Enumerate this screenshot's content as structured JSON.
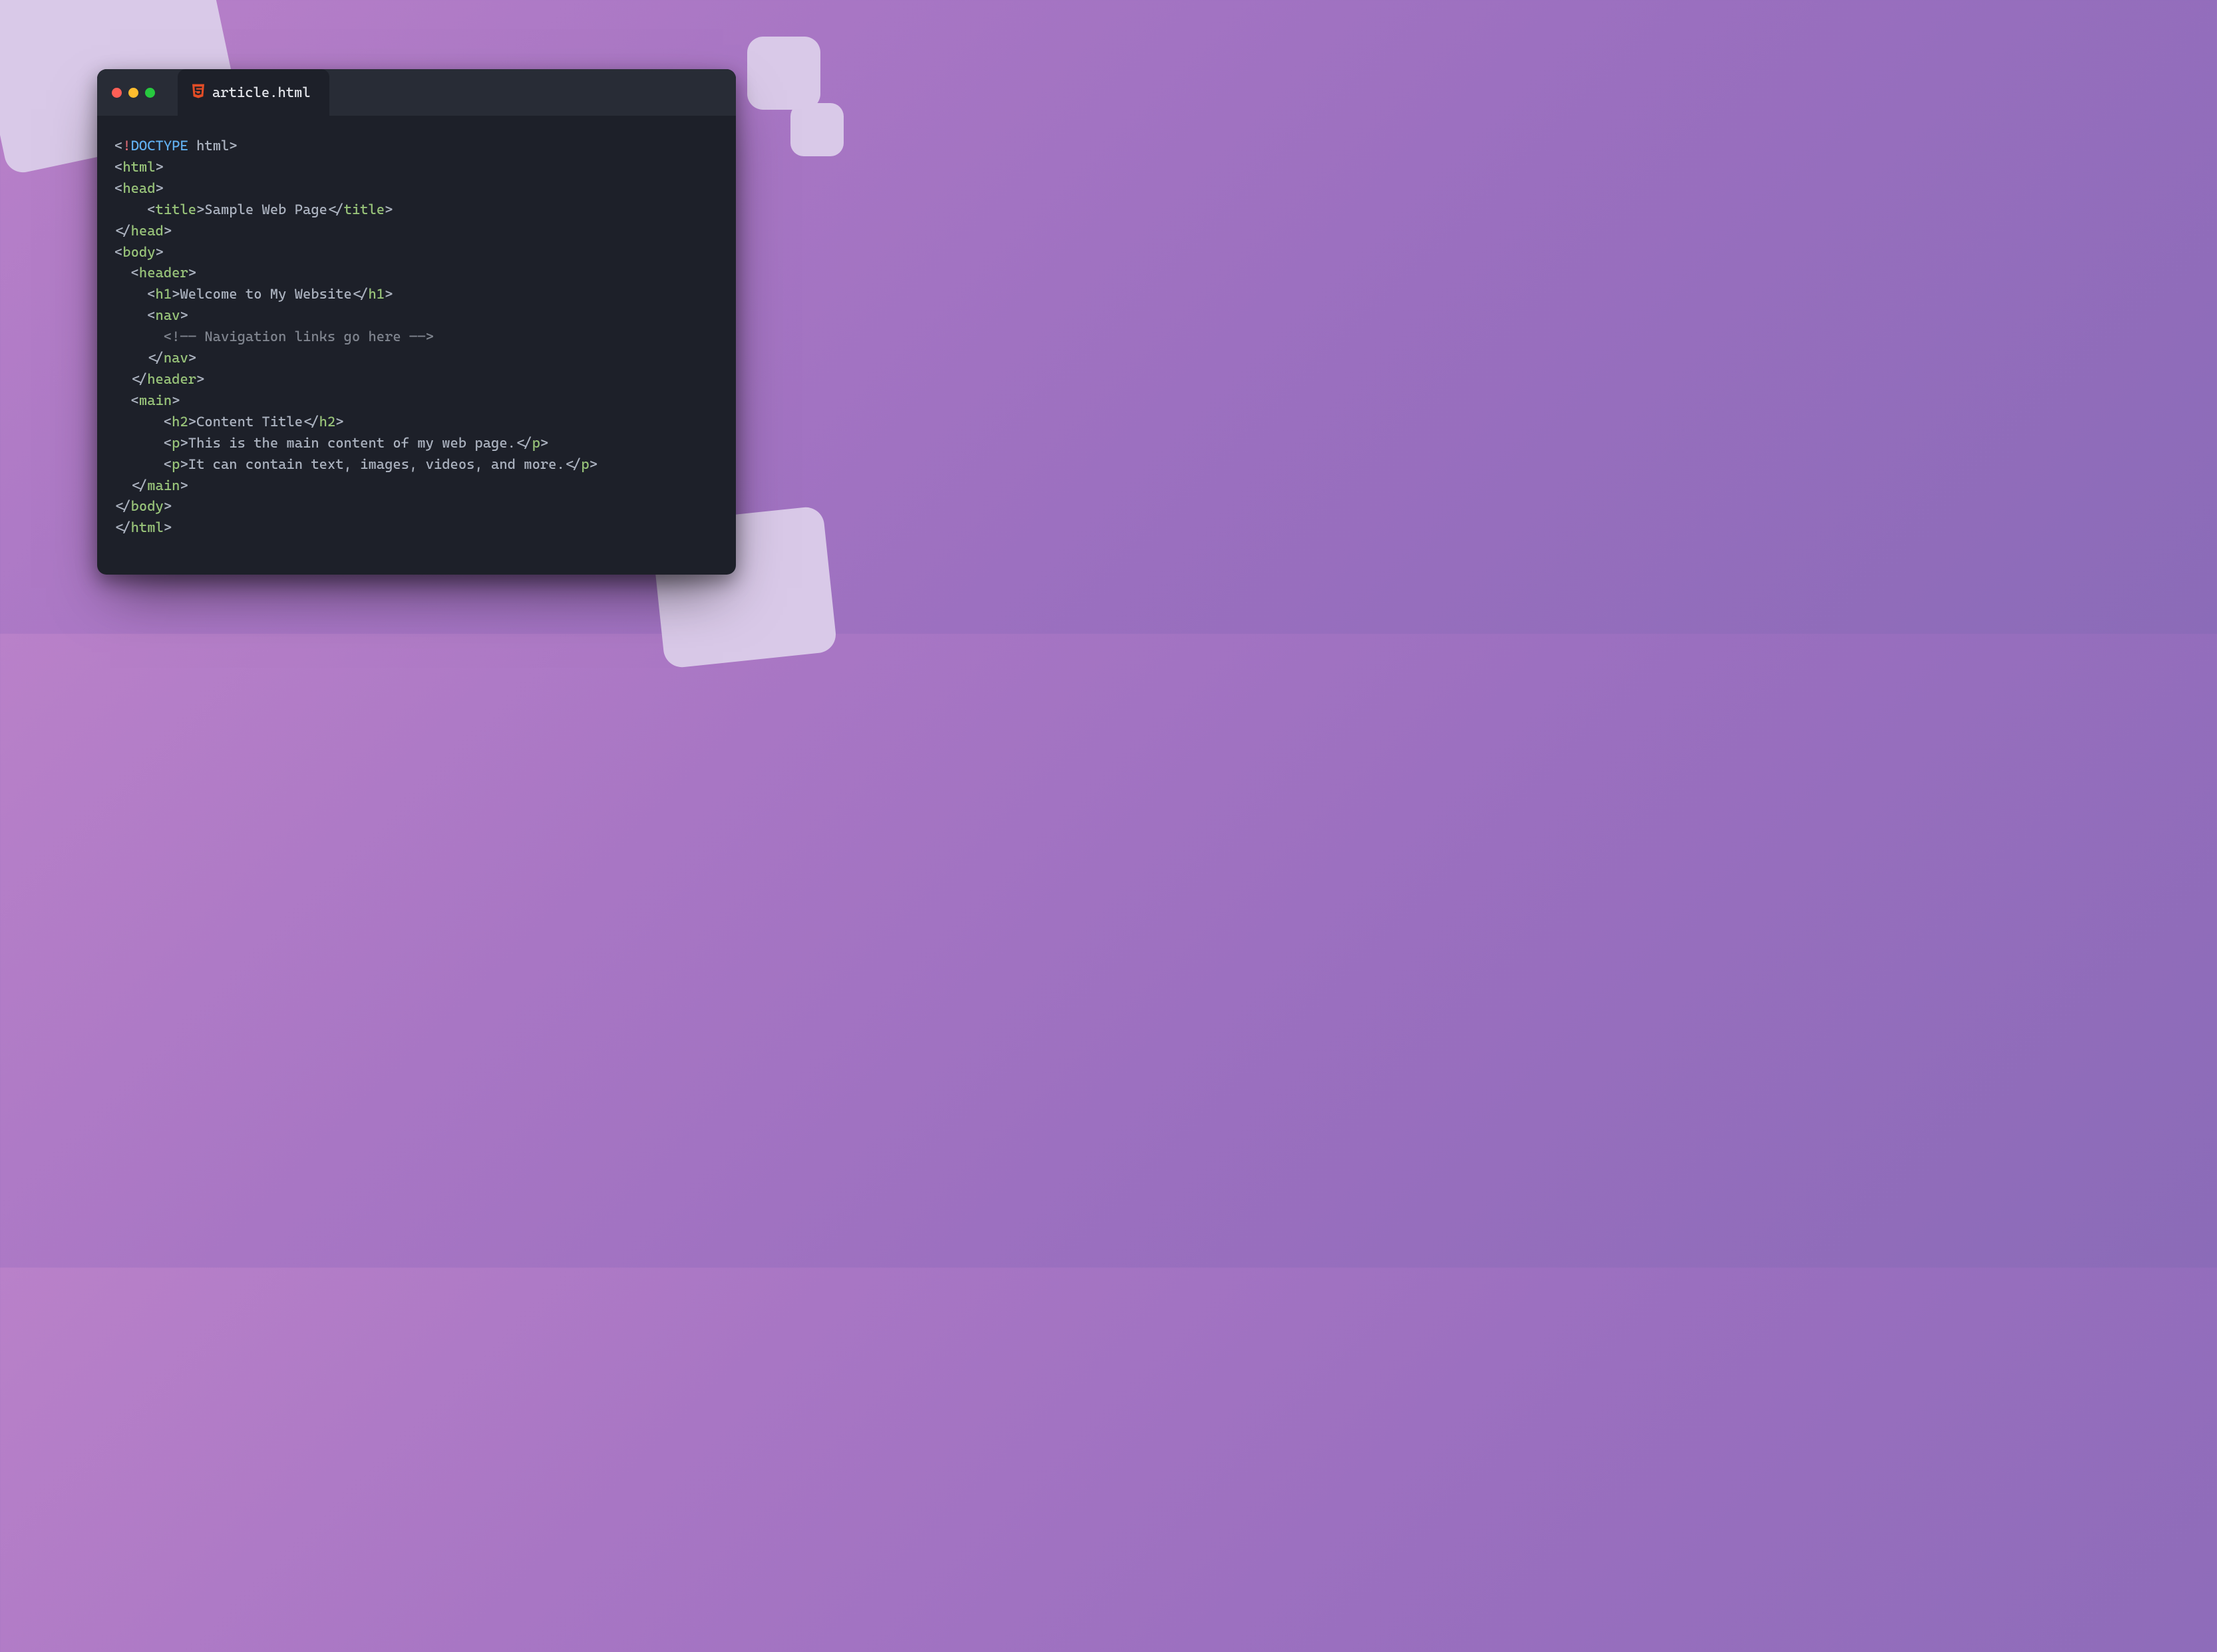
{
  "tab": {
    "filename": "article.html"
  },
  "code": {
    "l1_doctype": "DOCTYPE",
    "l1_html": "html",
    "tag_html": "html",
    "tag_head": "head",
    "tag_title": "title",
    "title_text": "Sample Web Page",
    "tag_body": "body",
    "tag_header": "header",
    "tag_h1": "h1",
    "h1_text": "Welcome to My Website",
    "tag_nav": "nav",
    "nav_comment": "Navigation links go here",
    "tag_main": "main",
    "tag_h2": "h2",
    "h2_text": "Content Title",
    "tag_p": "p",
    "p1_text": "This is the main content of my web page.",
    "p2_text": "It can contain text, images, videos, and more."
  }
}
